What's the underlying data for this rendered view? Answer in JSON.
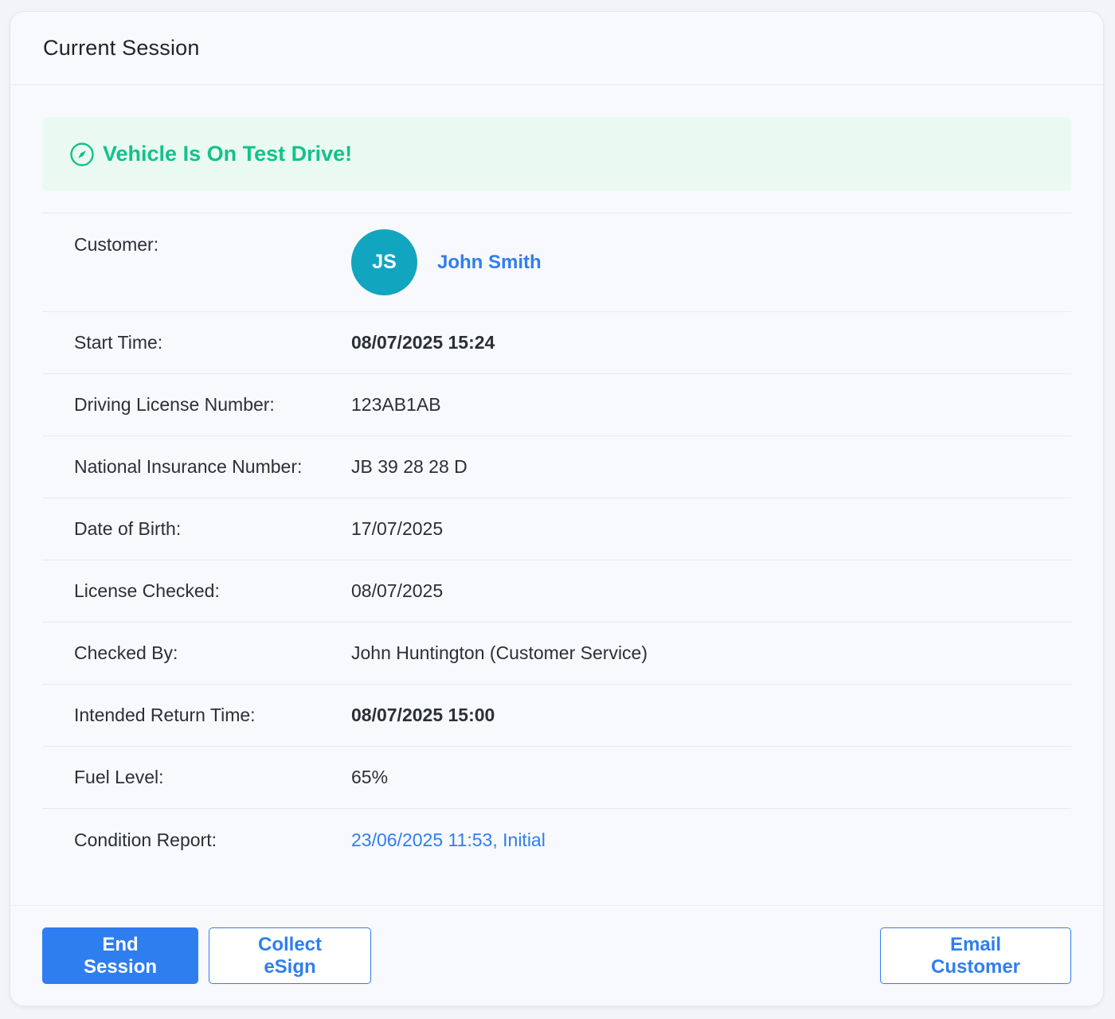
{
  "card": {
    "title": "Current Session"
  },
  "status": {
    "text": "Vehicle Is On Test Drive!",
    "color": "#12c28a",
    "icon": "compass-icon"
  },
  "customer": {
    "label": "Customer:",
    "initials": "JS",
    "name": "John Smith",
    "avatar_color": "#12a5bf"
  },
  "details": {
    "start_time": {
      "label": "Start Time:",
      "value": "08/07/2025 15:24"
    },
    "driving_license": {
      "label": "Driving License Number:",
      "value": "123AB1AB"
    },
    "national_insurance": {
      "label": "National Insurance Number:",
      "value": "JB 39 28 28 D"
    },
    "date_of_birth": {
      "label": "Date of Birth:",
      "value": "17/07/2025"
    },
    "license_checked": {
      "label": "License Checked:",
      "value": "08/07/2025"
    },
    "checked_by": {
      "label": "Checked By:",
      "value": "John Huntington (Customer Service)"
    },
    "intended_return": {
      "label": "Intended Return Time:",
      "value": "08/07/2025 15:00"
    },
    "fuel_level": {
      "label": "Fuel Level:",
      "value": "65%"
    },
    "condition_report": {
      "label": "Condition Report:",
      "value": "23/06/2025 11:53, Initial"
    }
  },
  "footer": {
    "end_session_label": "End Session",
    "collect_esign_label": "Collect eSign",
    "email_customer_label": "Email Customer"
  },
  "colors": {
    "accent": "#2f7ef0",
    "success": "#12c28a",
    "success_bg": "#eafaf3"
  }
}
